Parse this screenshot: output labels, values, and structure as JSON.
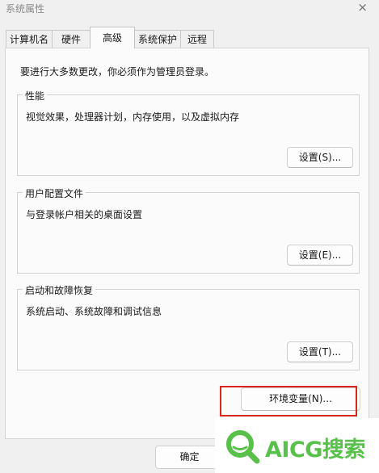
{
  "window": {
    "title": "系统属性",
    "close_glyph": "×"
  },
  "tabs": [
    {
      "label": "计算机名",
      "selected": false
    },
    {
      "label": "硬件",
      "selected": false
    },
    {
      "label": "高级",
      "selected": true
    },
    {
      "label": "系统保护",
      "selected": false
    },
    {
      "label": "远程",
      "selected": false
    }
  ],
  "advanced": {
    "notice": "要进行大多数更改，你必须作为管理员登录。",
    "performance": {
      "title": "性能",
      "description": "视觉效果，处理器计划，内存使用，以及虚拟内存",
      "button": "设置(S)..."
    },
    "user_profiles": {
      "title": "用户配置文件",
      "description": "与登录帐户相关的桌面设置",
      "button": "设置(E)..."
    },
    "startup_recovery": {
      "title": "启动和故障恢复",
      "description": "系统启动、系统故障和调试信息",
      "button": "设置(T)..."
    },
    "env_button": "环境变量(N)..."
  },
  "footer": {
    "ok_label": "确定"
  },
  "watermark": {
    "text": "AICG搜索",
    "color": "#59c14b"
  },
  "colors": {
    "highlight_box": "#d9281e"
  }
}
